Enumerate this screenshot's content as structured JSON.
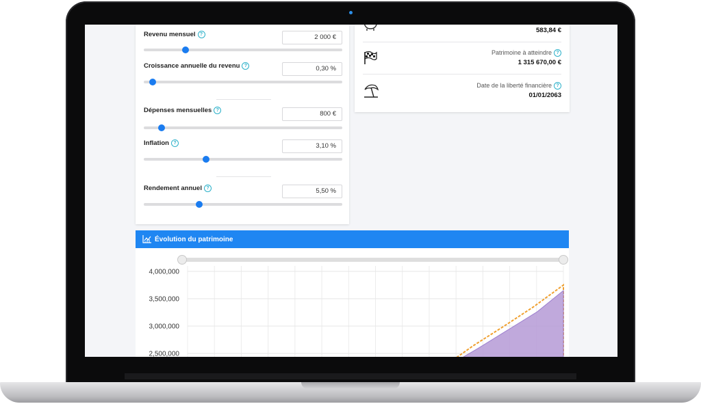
{
  "inputs": [
    {
      "label": "Revenu mensuel",
      "value": "2 000 €",
      "slider": 0.21
    },
    {
      "label": "Croissance annuelle du revenu",
      "value": "0,30 %",
      "slider": 0.045
    },
    {
      "label": "Dépenses mensuelles",
      "value": "800 €",
      "slider": 0.09
    },
    {
      "label": "Inflation",
      "value": "3,10 %",
      "slider": 0.315
    },
    {
      "label": "Rendement annuel",
      "value": "5,50 %",
      "slider": 0.28
    }
  ],
  "summary": {
    "top_value": "583,84 €",
    "target_label": "Patrimoine à atteindre",
    "target_value": "1 315 670,00 €",
    "freedom_label": "Date de la liberté financière",
    "freedom_value": "01/01/2063"
  },
  "chart": {
    "title": "Évolution du patrimoine",
    "accent": "#1f86f2"
  },
  "chart_data": {
    "type": "area",
    "title": "Évolution du patrimoine",
    "ylim": [
      2300000,
      4100000
    ],
    "y_ticks": [
      "4,000,000",
      "3,500,000",
      "3,000,000",
      "2,500,000"
    ],
    "y_tick_values": [
      4000000,
      3500000,
      3000000,
      2500000
    ],
    "grid": true,
    "series": [
      {
        "color": "#f0a030",
        "x": [
          0,
          0.69,
          0.76,
          0.84,
          0.92,
          1.0
        ],
        "values": [
          2300000,
          2300000,
          2640000,
          2990000,
          3350000,
          3750000
        ]
      },
      {
        "color": "#b59ad6",
        "x": [
          0,
          0.7,
          0.77,
          0.85,
          0.93,
          1.0
        ],
        "values": [
          2300000,
          2300000,
          2580000,
          2920000,
          3260000,
          3650000
        ]
      }
    ]
  }
}
